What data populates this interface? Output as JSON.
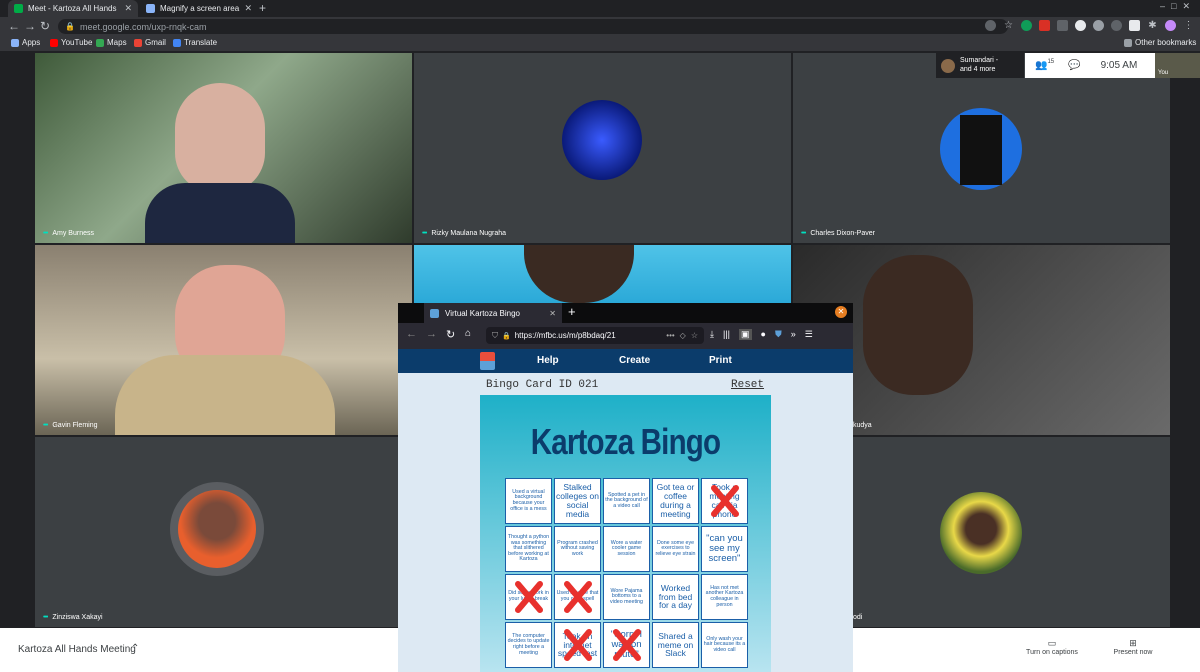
{
  "browser": {
    "tabs": [
      {
        "title": "Meet - Kartoza All Hands",
        "active": true
      },
      {
        "title": "Magnify a screen area",
        "active": false
      }
    ],
    "url": "meet.google.com/uxp-rnqk-cam",
    "bookmarks": [
      "Apps",
      "YouTube",
      "Maps",
      "Gmail",
      "Translate"
    ],
    "other_bookmarks": "Other bookmarks"
  },
  "meet": {
    "participants": [
      {
        "name": "Amy Burness"
      },
      {
        "name": "Rizky Maulana Nugraha"
      },
      {
        "name": "Charles Dixon-Paver"
      },
      {
        "name": "Gavin Fleming"
      },
      {
        "name": "kudya"
      },
      {
        "name": "Zinziswa Xakayi"
      },
      {
        "name": "odi"
      }
    ],
    "top_chip": {
      "name": "Sumandari -",
      "more": "and 4 more",
      "count": "15"
    },
    "clock": "9:05 AM",
    "self_label": "You",
    "meeting_title": "Kartoza All Hands Meeting",
    "captions_label": "Turn on captions",
    "present_label": "Present now"
  },
  "firefox": {
    "tab_title": "Virtual Kartoza Bingo",
    "url": "https://mfbc.us/m/p8bdaq/21",
    "url_more": "•••",
    "page": {
      "nav": [
        "Help",
        "Create",
        "Print"
      ],
      "card_id": "Bingo Card ID 021",
      "reset": "Reset",
      "title": "Kartoza Bingo",
      "cells": [
        {
          "text": "Used a virtual background because your office is a mess",
          "size": "s",
          "marked": false
        },
        {
          "text": "Stalked colleges on social media",
          "size": "l",
          "marked": false
        },
        {
          "text": "Spotted a pet in the background of a video call",
          "size": "s",
          "marked": false
        },
        {
          "text": "Got tea or coffee during a meeting",
          "size": "l",
          "marked": false
        },
        {
          "text": "Took a meeting call via phone",
          "size": "l",
          "marked": true
        },
        {
          "text": "Thought a python was something that slithered before working at Kartoza",
          "size": "s",
          "marked": false
        },
        {
          "text": "Program crashed without saving work",
          "size": "s",
          "marked": false
        },
        {
          "text": "Wore a water cooler game session",
          "size": "s",
          "marked": false
        },
        {
          "text": "Done some eye exercises to relieve eye strain",
          "size": "s",
          "marked": false
        },
        {
          "text": "\"can you see my screen\"",
          "size": "xl",
          "marked": false
        },
        {
          "text": "Did some work in your lunch break",
          "size": "s",
          "marked": true
        },
        {
          "text": "Used a name that you can't spell",
          "size": "s",
          "marked": true
        },
        {
          "text": "Wore Pajama bottoms to a video meeting",
          "size": "s",
          "marked": false
        },
        {
          "text": "Worked from bed for a day",
          "size": "l",
          "marked": false
        },
        {
          "text": "Has not met another Kartoza colleague in person",
          "size": "s",
          "marked": false
        },
        {
          "text": "The computer decides to update right before a meeting",
          "size": "s",
          "marked": false
        },
        {
          "text": "Took an internet speed test",
          "size": "l",
          "marked": true
        },
        {
          "text": "\"Sorry I was on mute\"",
          "size": "xl",
          "marked": true
        },
        {
          "text": "Shared a meme on Slack",
          "size": "l",
          "marked": false
        },
        {
          "text": "Only wash your hair because its a video call",
          "size": "s",
          "marked": false
        }
      ]
    }
  },
  "colors": {
    "mark": "#e8312d",
    "card_text": "#1b5fa8",
    "nav_bg": "#0b3c6b"
  }
}
